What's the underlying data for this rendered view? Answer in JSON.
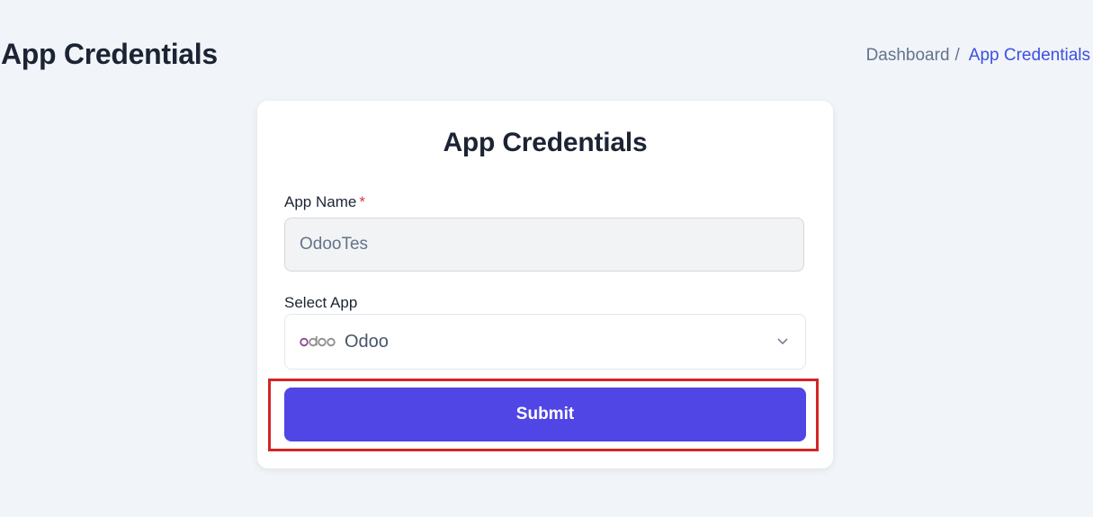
{
  "header": {
    "title": "App Credentials",
    "breadcrumb": {
      "home": "Dashboard",
      "separator": "/",
      "current": "App Credentials"
    }
  },
  "form": {
    "title": "App Credentials",
    "app_name": {
      "label": "App Name",
      "required_mark": "*",
      "value": "OdooTes"
    },
    "select_app": {
      "label": "Select App",
      "selected": "Odoo",
      "selected_icon": "odoo-logo-icon"
    },
    "submit_label": "Submit"
  },
  "colors": {
    "background": "#f1f4f9",
    "accent": "#4f46e5",
    "link": "#3c50e0",
    "highlight": "#d42427",
    "required": "#dc3545"
  }
}
